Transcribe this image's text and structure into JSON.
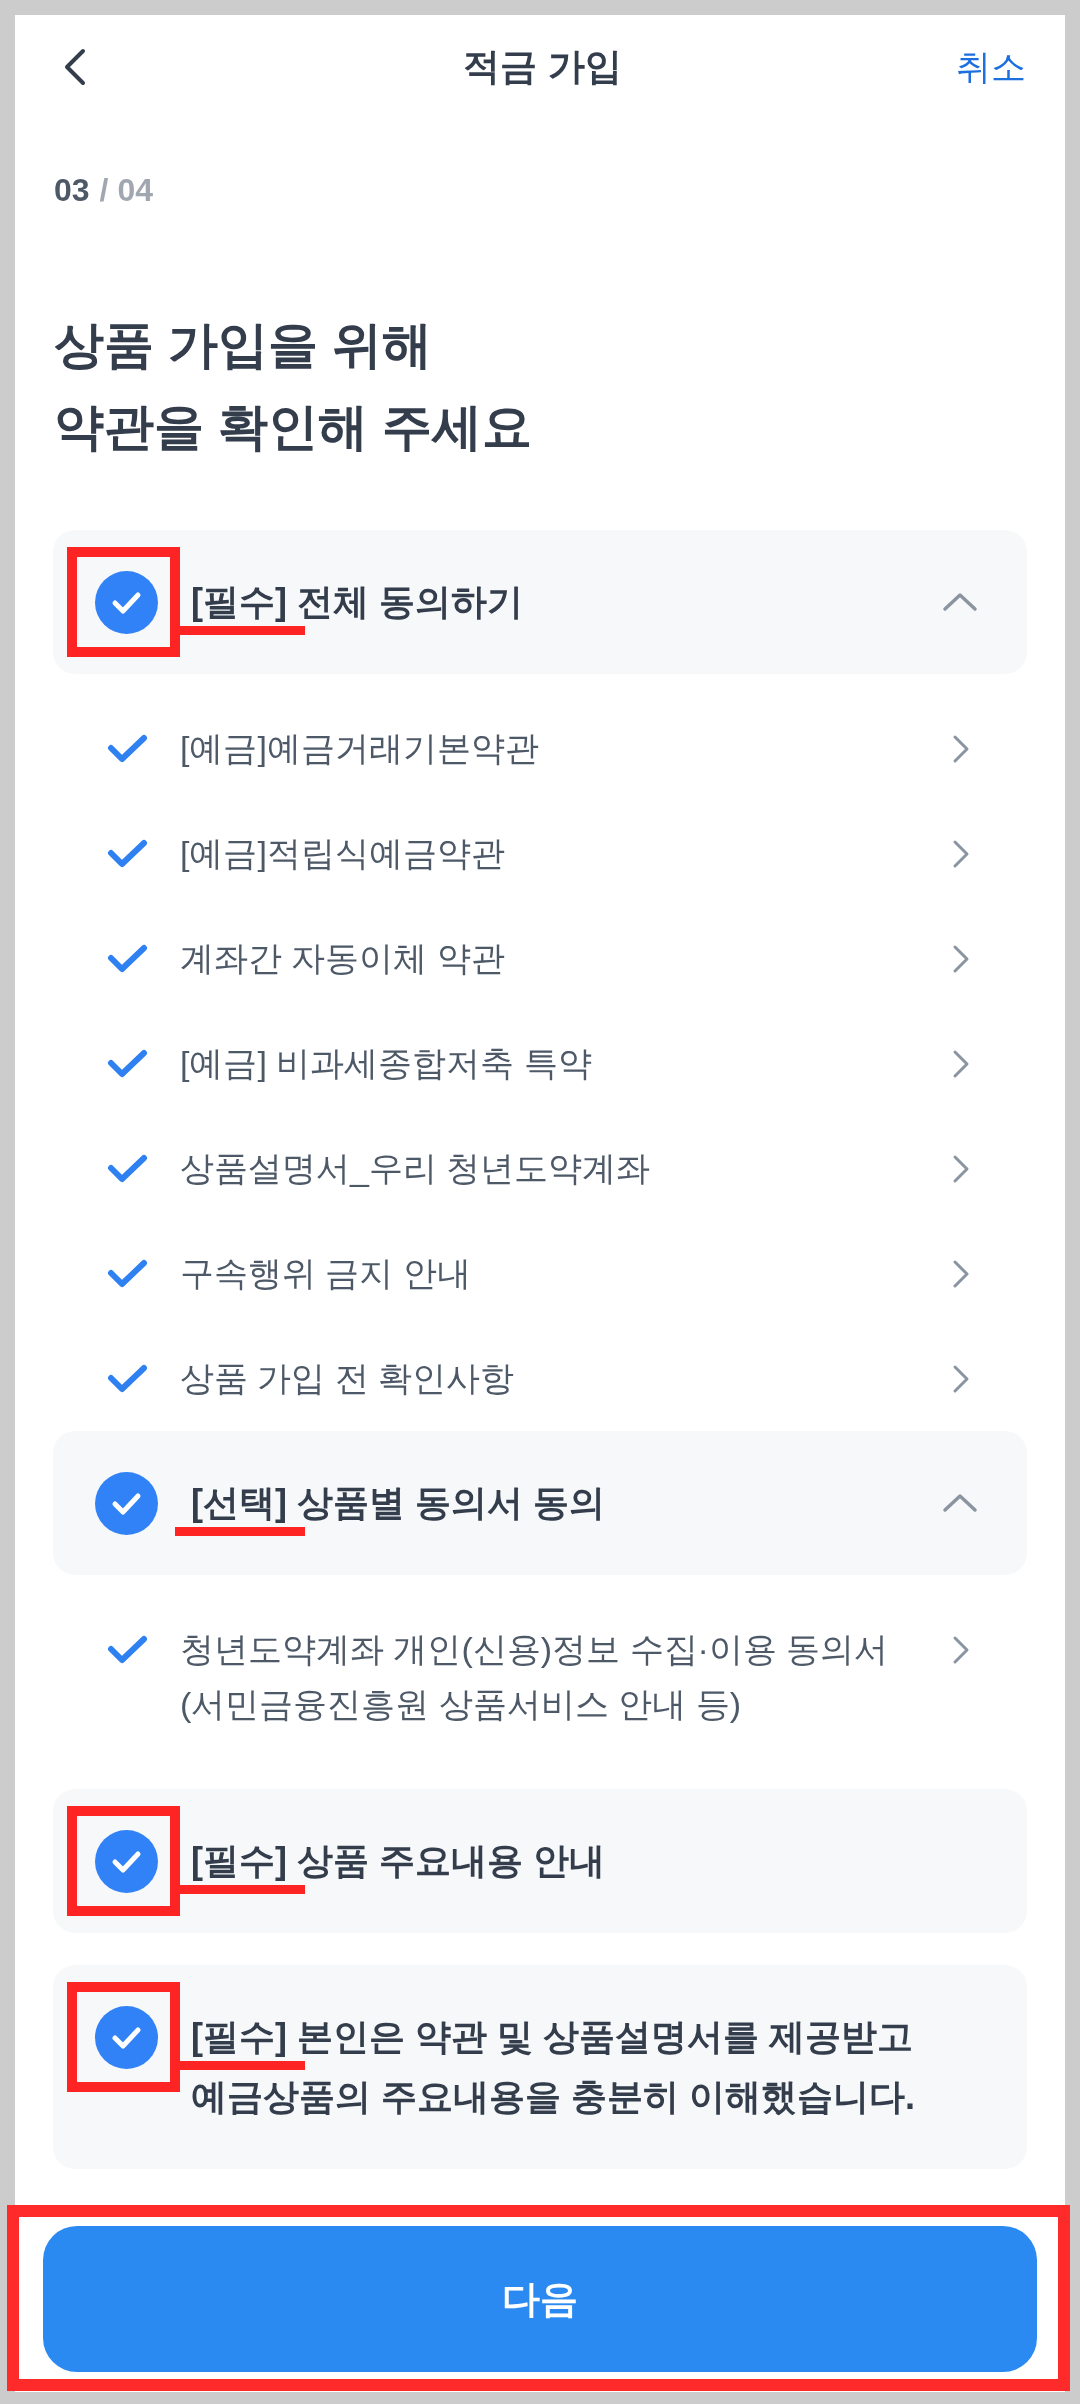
{
  "header": {
    "title": "적금 가입",
    "cancel": "취소"
  },
  "progress": {
    "current": "03",
    "total": "/ 04"
  },
  "heading": [
    "상품 가입을 위해",
    "약관을 확인해 주세요"
  ],
  "sections": [
    {
      "kind": "group",
      "label": "[필수] 전체 동의하기",
      "checked": true,
      "expanded": true,
      "highlighted": true,
      "tag_underlined": true,
      "items": [
        {
          "label": "[예금]예금거래기본약관",
          "checked": true
        },
        {
          "label": "[예금]적립식예금약관",
          "checked": true
        },
        {
          "label": "계좌간 자동이체 약관",
          "checked": true
        },
        {
          "label": "[예금] 비과세종합저축 특약",
          "checked": true
        },
        {
          "label": "상품설명서_우리 청년도약계좌",
          "checked": true
        },
        {
          "label": "구속행위 금지 안내",
          "checked": true
        },
        {
          "label": "상품 가입 전 확인사항",
          "checked": true
        }
      ]
    },
    {
      "kind": "group",
      "label": "[선택] 상품별 동의서 동의",
      "checked": true,
      "expanded": true,
      "highlighted": false,
      "tag_underlined": true,
      "items": [
        {
          "label": "청년도약계좌 개인(신용)정보 수집·이용 동의서 (서민금융진흥원 상품서비스 안내 등)",
          "checked": true
        }
      ]
    },
    {
      "kind": "single",
      "label": "[필수] 상품 주요내용 안내",
      "checked": true,
      "highlighted": true,
      "tag_underlined": true
    },
    {
      "kind": "single",
      "label": "[필수] 본인은 약관 및 상품설명서를 제공받고 예금상품의 주요내용을 충분히 이해했습니다.",
      "checked": true,
      "highlighted": true,
      "tag_underlined": true
    }
  ],
  "next_button": {
    "label": "다음",
    "highlighted": true
  }
}
